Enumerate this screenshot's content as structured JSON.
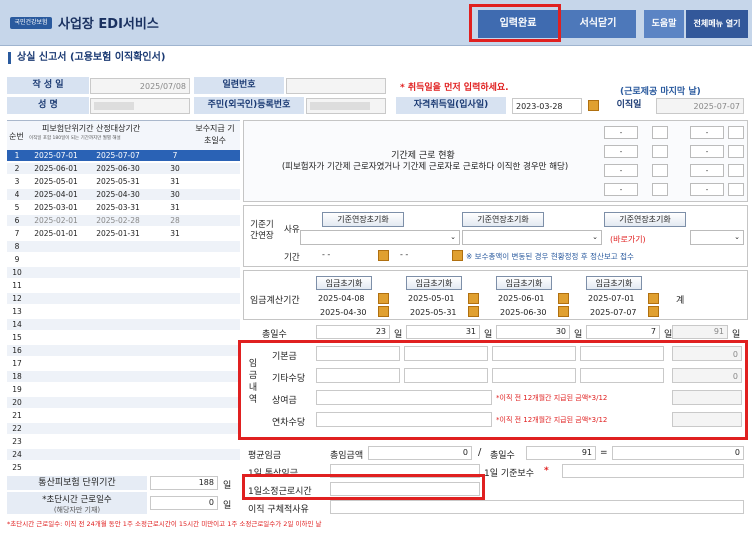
{
  "app": {
    "logo": "국민건강보험",
    "title": "사업장 EDI서비스"
  },
  "nav": {
    "submit": "입력완료",
    "close": "서식닫기",
    "help": "도움말",
    "all_menu": "전체메뉴 열기"
  },
  "section_title": "상실 신고서 (고용보험 이직확인서)",
  "form": {
    "writer_label": "작 성 일",
    "writer_date": "2025/07/08",
    "serial_label": "일련번호",
    "warning": "* 취득일을 먼저 입력하세요.",
    "workday_hint": "(근로제공 마지막 날)",
    "name_label": "성    명",
    "rrn_label": "주민(외국인)등록번호",
    "acq_label": "자격취득일(입사일)",
    "acq_date": "2023-03-28",
    "leave_label": "이직일",
    "leave_date": "2025-07-07"
  },
  "left": {
    "col_no": "순번",
    "col_period": "피보험단위기간 산정대상기간",
    "col_period_note": "이직일 포함 180일이 되는 기간까지만 월별 해설",
    "col_days": "보수지급 기초일수",
    "rows": [
      {
        "no": "1",
        "from": "2025-07-01",
        "to": "2025-07-07",
        "days": "7"
      },
      {
        "no": "2",
        "from": "2025-06-01",
        "to": "2025-06-30",
        "days": "30"
      },
      {
        "no": "3",
        "from": "2025-05-01",
        "to": "2025-05-31",
        "days": "31"
      },
      {
        "no": "4",
        "from": "2025-04-01",
        "to": "2025-04-30",
        "days": "30"
      },
      {
        "no": "5",
        "from": "2025-03-01",
        "to": "2025-03-31",
        "days": "31"
      },
      {
        "no": "6",
        "from": "2025-02-01",
        "to": "2025-02-28",
        "days": "28"
      },
      {
        "no": "7",
        "from": "2025-01-01",
        "to": "2025-01-31",
        "days": "31"
      },
      {
        "no": "8",
        "from": "",
        "to": "",
        "days": ""
      },
      {
        "no": "9",
        "from": "",
        "to": "",
        "days": ""
      },
      {
        "no": "10",
        "from": "",
        "to": "",
        "days": ""
      },
      {
        "no": "11",
        "from": "",
        "to": "",
        "days": ""
      },
      {
        "no": "12",
        "from": "",
        "to": "",
        "days": ""
      },
      {
        "no": "13",
        "from": "",
        "to": "",
        "days": ""
      },
      {
        "no": "14",
        "from": "",
        "to": "",
        "days": ""
      },
      {
        "no": "15",
        "from": "",
        "to": "",
        "days": ""
      },
      {
        "no": "16",
        "from": "",
        "to": "",
        "days": ""
      },
      {
        "no": "17",
        "from": "",
        "to": "",
        "days": ""
      },
      {
        "no": "18",
        "from": "",
        "to": "",
        "days": ""
      },
      {
        "no": "19",
        "from": "",
        "to": "",
        "days": ""
      },
      {
        "no": "20",
        "from": "",
        "to": "",
        "days": ""
      },
      {
        "no": "21",
        "from": "",
        "to": "",
        "days": ""
      },
      {
        "no": "22",
        "from": "",
        "to": "",
        "days": ""
      },
      {
        "no": "23",
        "from": "",
        "to": "",
        "days": ""
      },
      {
        "no": "24",
        "from": "",
        "to": "",
        "days": ""
      },
      {
        "no": "25",
        "from": "",
        "to": "",
        "days": ""
      }
    ],
    "total_label": "통산피보험 단위기간",
    "total_days": "188",
    "day_unit": "일",
    "short_label": "*초단시간 근로일수",
    "short_sub": "(해당자만 기재)",
    "short_days": "0",
    "footnote": "*초단시간 근로일수: 이직 전 24개월 동안 1주 소정근로시간이 15시간 미만이고 1주 소정근로일수가 2일 이하인 날"
  },
  "contract": {
    "line1": "기간제 근로 현황",
    "line2": "(피보험자가 기간제 근로자였거나 기간제 근로자로 근로하다 이직한 경우만 해당)",
    "dash": "-"
  },
  "extension": {
    "label": "기준기간연장",
    "reason": "사유",
    "period": "기간",
    "reset": "기준연장초기화",
    "shortcut": "(바로가기)",
    "dash": "- -",
    "notice": "※ 보수총액이 변동된 경우 현황정정 후 정산보고 접수"
  },
  "wage": {
    "calc_label": "임금계산기간",
    "reset": "임금초기화",
    "total_label": "계",
    "periods": [
      {
        "from": "2025-04-08",
        "to": "2025-04-30"
      },
      {
        "from": "2025-05-01",
        "to": "2025-05-31"
      },
      {
        "from": "2025-06-01",
        "to": "2025-06-30"
      },
      {
        "from": "2025-07-01",
        "to": "2025-07-07"
      }
    ],
    "days_label": "총일수",
    "days": [
      "23",
      "31",
      "30",
      "7"
    ],
    "days_total": "91",
    "day_unit": "일",
    "section_label": "임금내역",
    "rows": [
      {
        "label": "기본금",
        "total": "0"
      },
      {
        "label": "기타수당",
        "total": "0"
      },
      {
        "label": "상여금",
        "note": "*이직 전 12개월간 지급된 금액*3/12"
      },
      {
        "label": "연차수당",
        "note": "*이직 전 12개월간 지급된 금액*3/12"
      }
    ]
  },
  "avg": {
    "label": "평균임금",
    "total_label": "총임금액",
    "total": "0",
    "div": "/",
    "days_label": "총일수",
    "days": "91",
    "eq": "=",
    "result": "0"
  },
  "daily": {
    "label": "1일 통상임금",
    "base_label": "1일 기준보수",
    "star": "*"
  },
  "hours": {
    "label": "1일소정근로시간"
  },
  "reason": {
    "label": "이직 구체적사유"
  }
}
